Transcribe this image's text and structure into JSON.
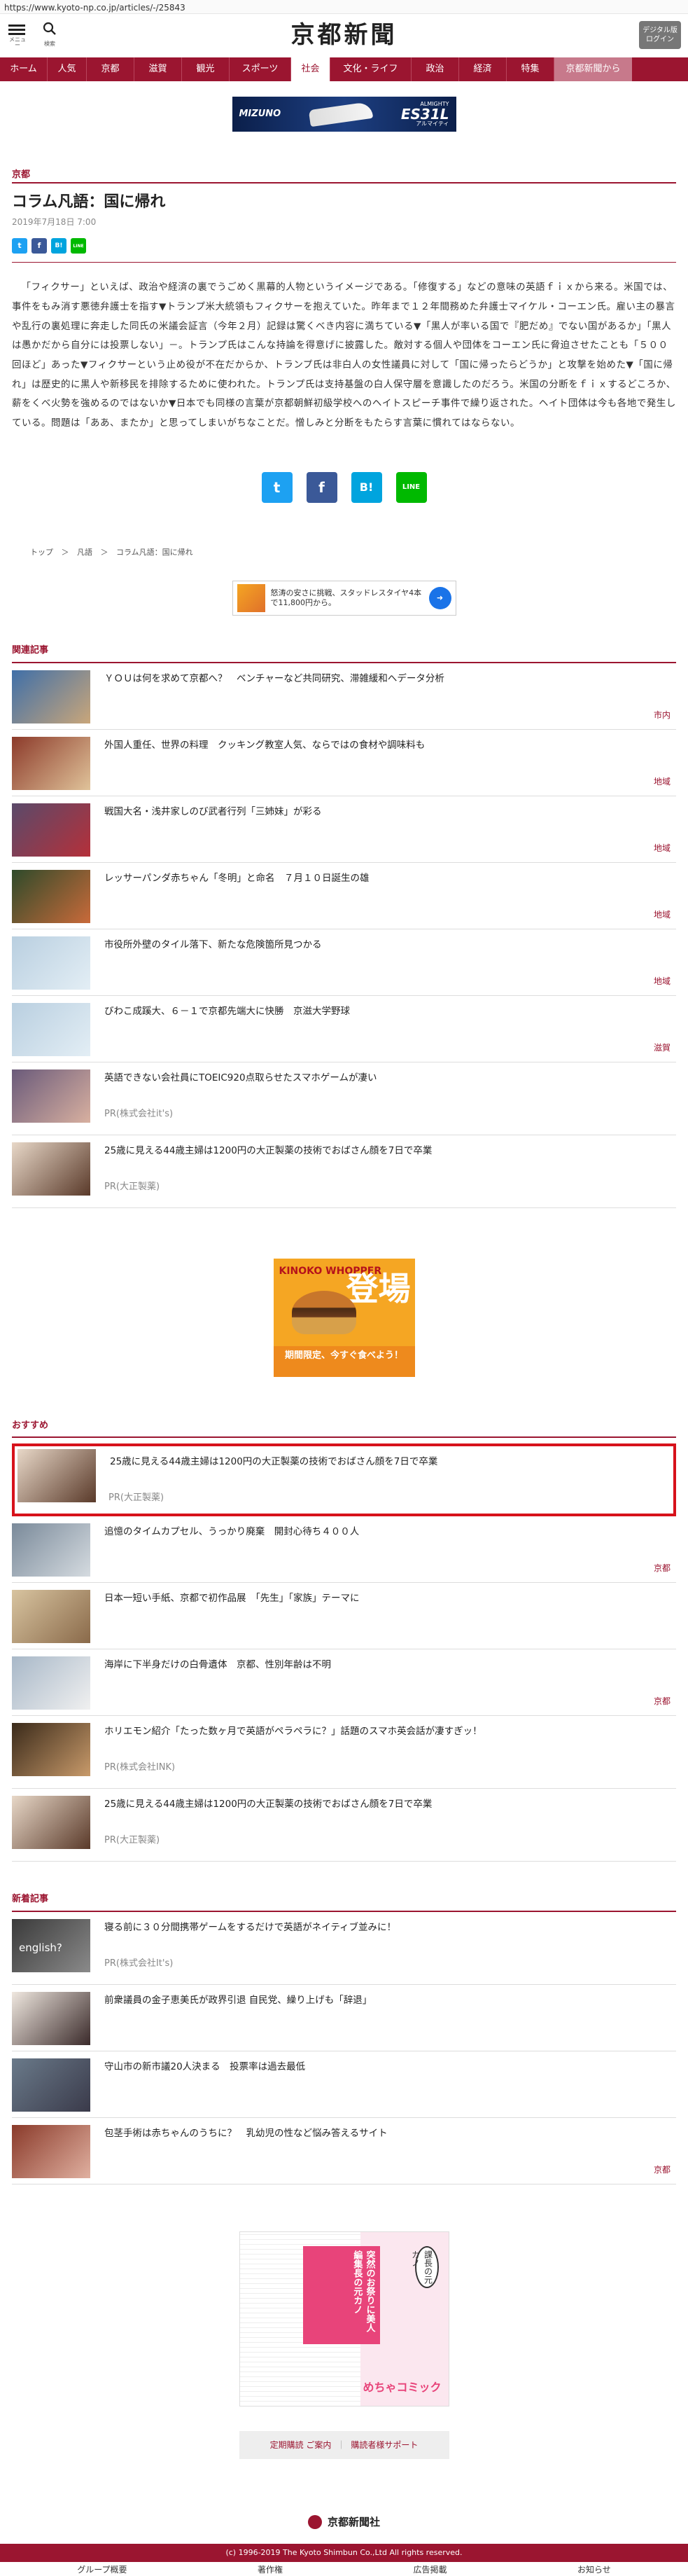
{
  "browser": {
    "url": "https://www.kyoto-np.co.jp/articles/-/25843"
  },
  "header": {
    "menu_label": "メニュー",
    "search_label": "検索",
    "logo": "京都新聞",
    "login_line1": "デジタル版",
    "login_line2": "ログイン"
  },
  "nav": {
    "items": [
      "ホーム",
      "人気",
      "京都",
      "滋賀",
      "観光",
      "スポーツ",
      "社会",
      "文化・ライフ",
      "政治",
      "経済",
      "特集",
      "京都新聞から"
    ],
    "active": "社会"
  },
  "ads": {
    "top": {
      "brand": "MIZUNO",
      "model": "ALMIGHTY",
      "model_code": "ES31L",
      "model_sub": "アルマイティ"
    },
    "rakuten": {
      "text": "怒涛の安さに挑戦、スタッドレスタイヤ4本で11,800円から。"
    },
    "kinoko": {
      "line1": "KINOKO WHOPPER",
      "big": "登場",
      "bottom": "期間限定、今すぐ食べよう！"
    },
    "manga": {
      "text": "突然のお祭りに美人編集長の元カノ",
      "name": "課長の元カノ",
      "logo": "めちゃコミック"
    }
  },
  "article": {
    "category": "京都",
    "title": "コラム凡語：国に帰れ",
    "date": "2019年7月18日 7:00",
    "body": "「フィクサー」といえば、政治や経済の裏でうごめく黒幕的人物というイメージである。「修復する」などの意味の英語ｆｉｘから来る。米国では、事件をもみ消す悪徳弁護士を指す▼トランプ米大統領もフィクサーを抱えていた。昨年まで１２年間務めた弁護士マイケル・コーエン氏。雇い主の暴言や乱行の裏処理に奔走した同氏の米議会証言（今年２月）記録は驚くべき内容に満ちている▼「黒人が率いる国で『肥だめ』でない国があるか」「黒人は愚かだから自分には投票しない」－。トランプ氏はこんな持論を得意げに披露した。敵対する個人や団体をコーエン氏に脅迫させたことも「５００回ほど」あった▼フィクサーという止め役が不在だからか、トランプ氏は非白人の女性議員に対して「国に帰ったらどうか」と攻撃を始めた▼「国に帰れ」は歴史的に黒人や新移民を排除するために使われた。トランプ氏は支持基盤の白人保守層を意識したのだろう。米国の分断をｆｉｘするどころか、薪をくべ火勢を強めるのではないか▼日本でも同様の言葉が京都朝鮮初級学校へのヘイトスピーチ事件で繰り返された。ヘイト団体は今も各地で発生している。問題は「ああ、またか」と思ってしまいがちなことだ。憎しみと分断をもたらす言葉に慣れてはならない。"
  },
  "share": {
    "twitter": "t",
    "facebook": "f",
    "hatena": "B!",
    "line": "LINE"
  },
  "breadcrumb": [
    "トップ",
    "＞",
    "凡語",
    "＞",
    "コラム凡語：国に帰れ"
  ],
  "related": {
    "heading": "関連記事",
    "items": [
      {
        "title": "ＹＯＵは何を求めて京都へ？　ベンチャーなど共同研究、滞雑緩和へデータ分析",
        "tag": "市内",
        "thumb": [
          "#3f6fa8",
          "#c9a67a"
        ]
      },
      {
        "title": "外国人重任、世界の料理　クッキング教室人気、ならではの食材や調味料も",
        "tag": "地域",
        "thumb": [
          "#8c3a2a",
          "#e0c39a"
        ]
      },
      {
        "title": "戦国大名・浅井家しのび武者行列「三姉妹」が彩る",
        "tag": "地域",
        "thumb": [
          "#5a4a6a",
          "#b5303a"
        ]
      },
      {
        "title": "レッサーパンダ赤ちゃん「冬明」と命名　７月１０日誕生の雄",
        "tag": "地域",
        "thumb": [
          "#2e4a2a",
          "#c96a3a"
        ]
      },
      {
        "title": "市役所外壁のタイル落下、新たな危険箇所見つかる",
        "tag": "地域",
        "thumb": [
          "#b9cfe0",
          "#e3eef5"
        ]
      },
      {
        "title": "びわこ成蹊大、６－１で京都先端大に快勝　京滋大学野球",
        "tag": "滋賀",
        "thumb": [
          "#b9cfe0",
          "#e3eef5"
        ]
      }
    ],
    "pr_items": [
      {
        "title": "英語できない会社員にTOEIC920点取らせたスマホゲームが凄い",
        "pr": "PR(株式会社it's)",
        "thumb": [
          "#6a5a7a",
          "#d8b0a0"
        ]
      },
      {
        "title": "25歳に見える44歳主婦は1200円の大正製薬の技術でおばさん顔を7日で卒業",
        "pr": "PR(大正製薬)",
        "thumb": [
          "#e8d8c8",
          "#5a3a2a"
        ]
      }
    ]
  },
  "recommend": {
    "heading": "おすすめ",
    "highlighted": {
      "title": "25歳に見える44歳主婦は1200円の大正製薬の技術でおばさん顔を7日で卒業",
      "pr": "PR(大正製薬)",
      "thumb": [
        "#e8d8c8",
        "#5a3a2a"
      ]
    },
    "items": [
      {
        "title": "追憶のタイムカプセル、うっかり廃棄　開封心待ち４００人",
        "tag": "京都",
        "thumb": [
          "#7a8a9a",
          "#d5dbe0"
        ]
      },
      {
        "title": "日本一短い手紙、京都で初作品展　「先生」「家族」テーマに",
        "tag": "",
        "thumb": [
          "#d8c4a0",
          "#8a6a4a"
        ]
      },
      {
        "title": "海岸に下半身だけの白骨遺体　京都、性別年齢は不明",
        "tag": "京都",
        "thumb": [
          "#a8b8c8",
          "#f0f0f0"
        ]
      },
      {
        "title": "ホリエモン紹介「たった数ヶ月で英語がペラペラに？」話題のスマホ英会話が凄すぎッ！",
        "pr": "PR(株式会社INK)",
        "thumb": [
          "#3a2a1a",
          "#c89a6a"
        ]
      },
      {
        "title": "25歳に見える44歳主婦は1200円の大正製薬の技術でおばさん顔を7日で卒業",
        "pr": "PR(大正製薬)",
        "thumb": [
          "#e8d8c8",
          "#5a3a2a"
        ]
      }
    ]
  },
  "newest": {
    "heading": "新着記事",
    "items": [
      {
        "title": "寝る前に３０分間携帯ゲームをするだけで英語がネイティブ並みに！",
        "pr": "PR(株式会社It's)",
        "thumb": [
          "#3a3a3a",
          "#8a8a8a"
        ],
        "thumb_text": "english?"
      },
      {
        "title": "前衆議員の金子恵美氏が政界引退 自民党、繰り上げも「辞退」",
        "tag": "",
        "thumb": [
          "#f0e8e0",
          "#3a2a2a"
        ]
      },
      {
        "title": "守山市の新市議20人決まる　投票率は過去最低",
        "tag": "",
        "thumb": [
          "#6a7a8a",
          "#3a3a4a"
        ]
      },
      {
        "title": "包茎手術は赤ちゃんのうちに？　乳幼児の性など悩み答えるサイト",
        "tag": "京都",
        "thumb": [
          "#8a3a2a",
          "#e0b0a0"
        ]
      }
    ]
  },
  "footer": {
    "subscribe": "定期購読 ご案内",
    "separator": "｜",
    "support": "購読者様サポート",
    "company": "京都新聞社",
    "links": [
      "グループ概要",
      "著作権",
      "広告掲載",
      "お知らせ"
    ],
    "copyright": "(c) 1996-2019 The Kyoto Shimbun Co.,Ltd All rights reserved."
  }
}
